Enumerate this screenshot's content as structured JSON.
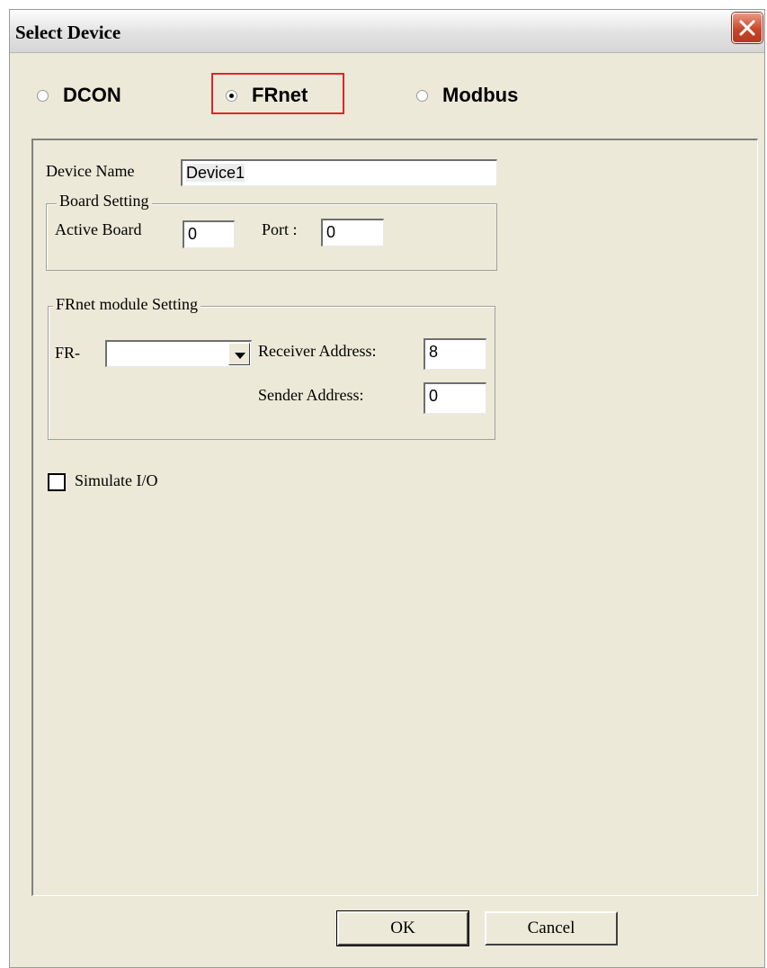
{
  "window": {
    "title": "Select Device"
  },
  "protocol": {
    "options": [
      "DCON",
      "FRnet",
      "Modbus"
    ],
    "selected": "FRnet"
  },
  "device": {
    "name_label": "Device Name",
    "name_value": "Device1"
  },
  "board_setting": {
    "legend": "Board Setting",
    "active_board_label": "Active  Board",
    "active_board_value": "0",
    "port_label": "Port :",
    "port_value": "0"
  },
  "frnet_setting": {
    "legend": "FRnet module Setting",
    "fr_label": "FR-",
    "fr_value": "",
    "receiver_label": "Receiver Address:",
    "receiver_value": "8",
    "sender_label": "Sender Address:",
    "sender_value": "0"
  },
  "simulate": {
    "label": "Simulate I/O",
    "checked": false
  },
  "buttons": {
    "ok": "OK",
    "cancel": "Cancel"
  }
}
